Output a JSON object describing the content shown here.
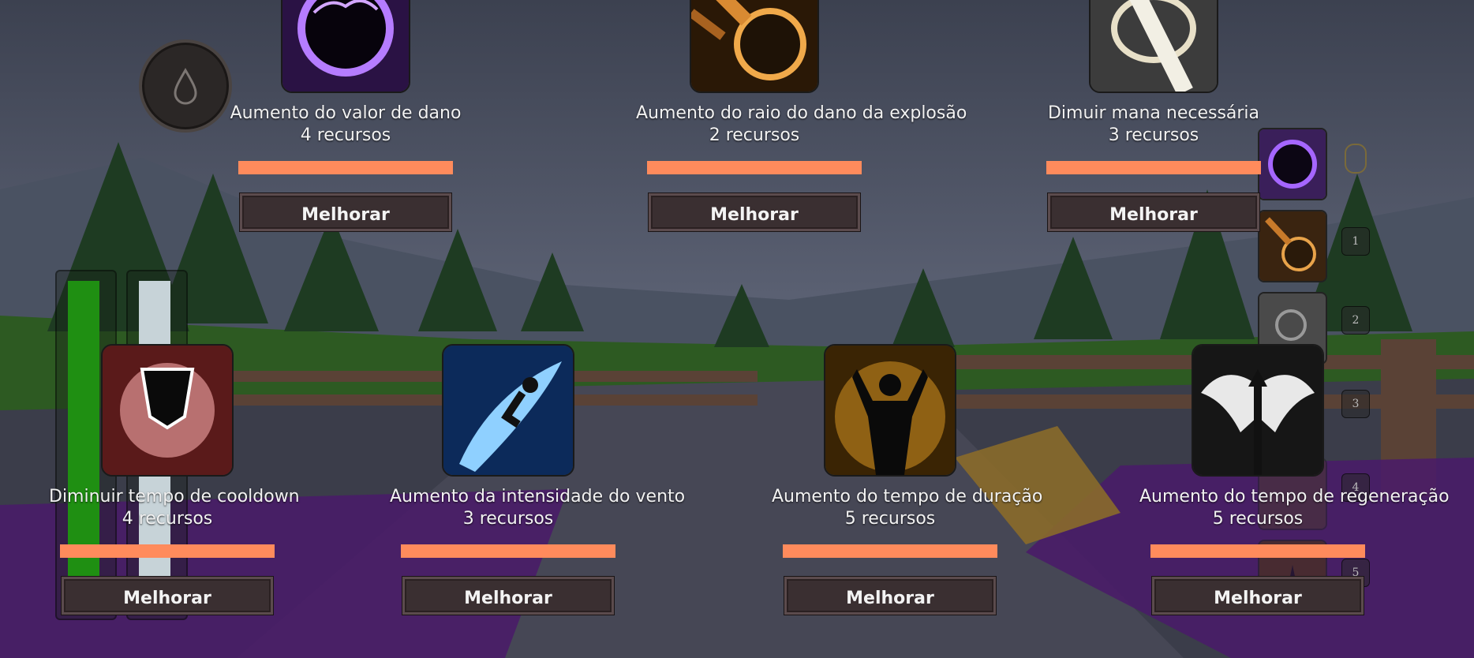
{
  "upgrades_top": [
    {
      "title": "Aumento do valor de dano",
      "cost": "4 recursos",
      "button": "Melhorar",
      "icon": "void-orb-icon"
    },
    {
      "title": "Aumento do raio do dano da explosão",
      "cost": "2 recursos",
      "button": "Melhorar",
      "icon": "meteor-icon"
    },
    {
      "title": "Dimuir mana necessária",
      "cost": "3 recursos",
      "button": "Melhorar",
      "icon": "light-ray-icon"
    }
  ],
  "upgrades_bottom": [
    {
      "title": "Diminuir tempo de cooldown",
      "cost": "4 recursos",
      "button": "Melhorar",
      "icon": "shattered-hand-icon"
    },
    {
      "title": "Aumento da intensidade do vento",
      "cost": "3 recursos",
      "button": "Melhorar",
      "icon": "wind-dash-icon"
    },
    {
      "title": "Aumento do tempo de duração",
      "cost": "5 recursos",
      "button": "Melhorar",
      "icon": "power-figure-icon"
    },
    {
      "title": "Aumento do tempo de regeneração",
      "cost": "5 recursos",
      "button": "Melhorar",
      "icon": "angel-wings-icon"
    }
  ],
  "hotbar": {
    "numbers": [
      "1",
      "2",
      "3",
      "4",
      "5"
    ]
  },
  "colors": {
    "progress_bar": "#ff8b5c",
    "button_bg": "#3a2f31",
    "health_meter": "#1f8f12",
    "mana_meter": "#c7d3d8"
  }
}
